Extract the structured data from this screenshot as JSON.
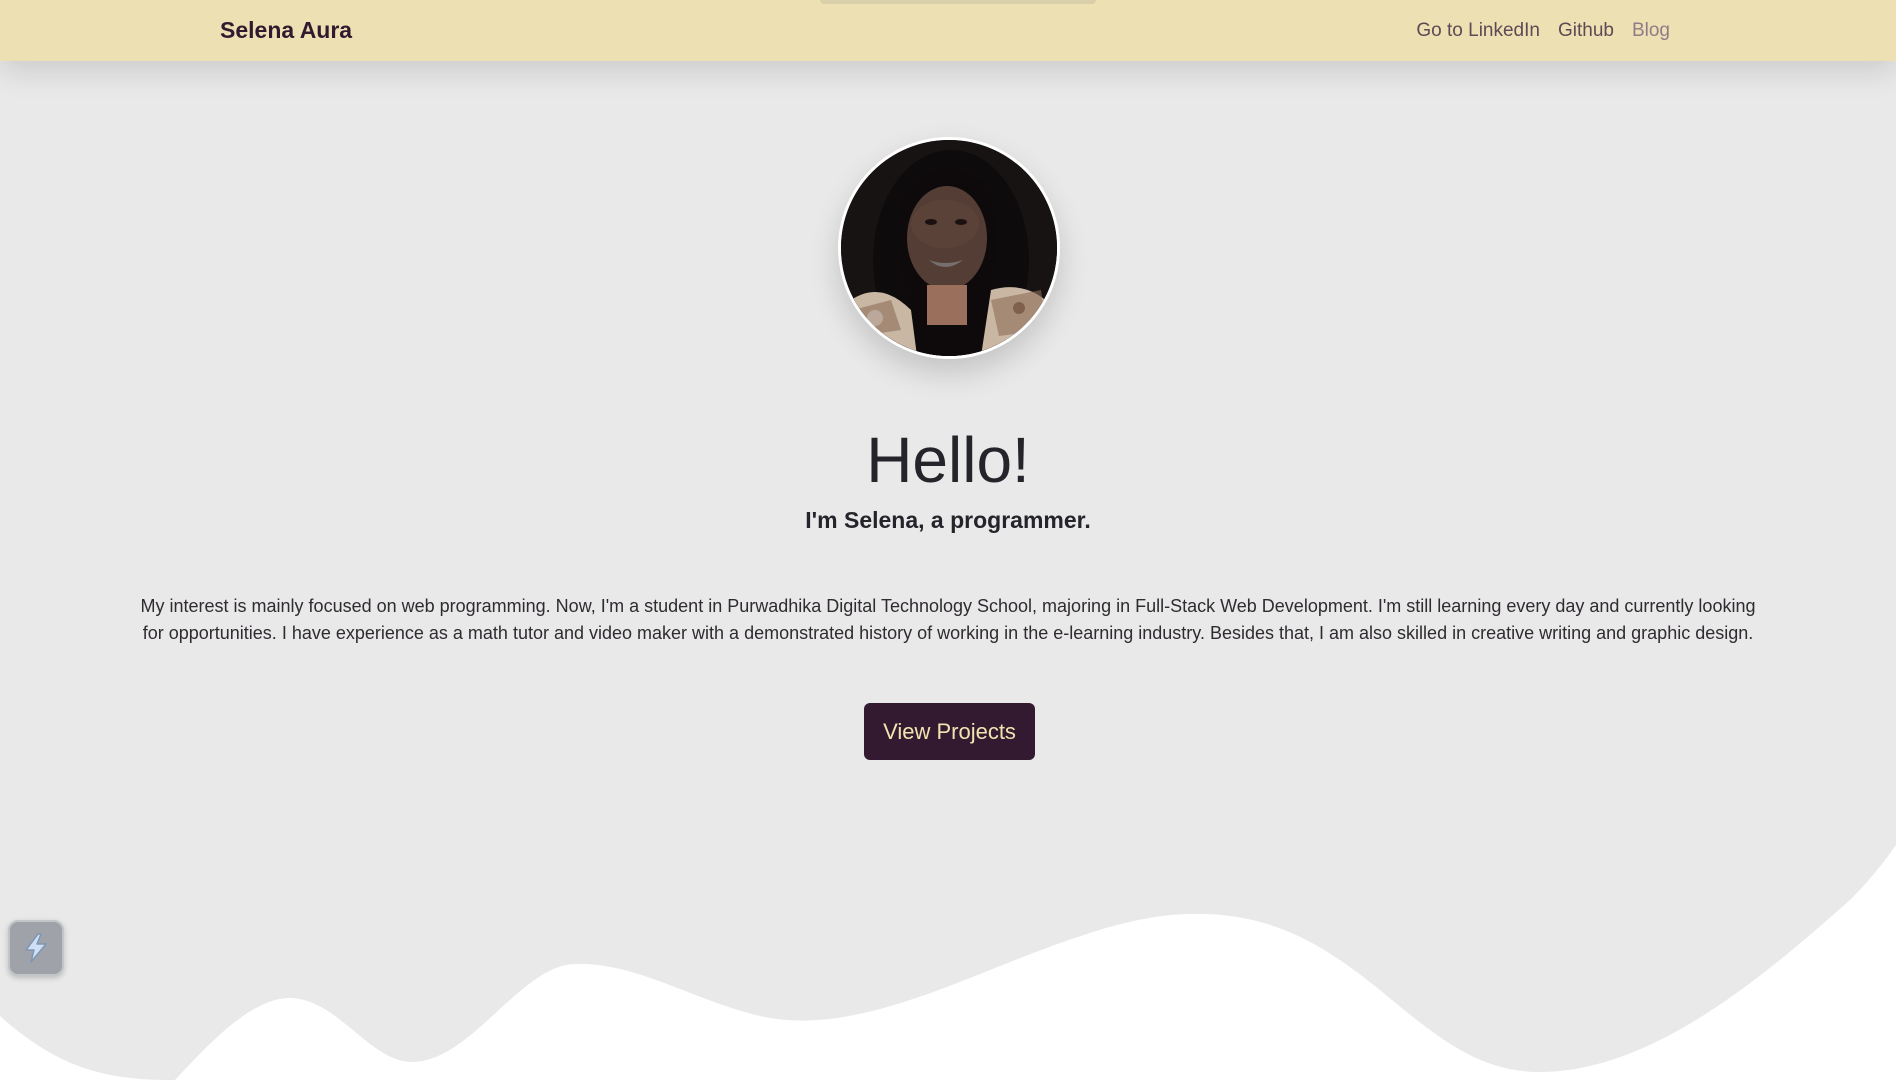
{
  "navbar": {
    "brand": "Selena Aura",
    "links": [
      {
        "label": "Go to LinkedIn"
      },
      {
        "label": "Github"
      },
      {
        "label": "Blog"
      }
    ]
  },
  "hero": {
    "title": "Hello!",
    "subtitle": "I'm Selena, a programmer.",
    "bio": "My interest is mainly focused on web programming. Now, I'm a student in Purwadhika Digital Technology School, majoring in Full-Stack Web Development. I'm still learning every day and currently looking for opportunities. I have experience as a math tutor and video maker with a demonstrated history of working in the e-learning industry. Besides that, I am also skilled in creative writing and graphic design.",
    "cta_label": "View Projects"
  },
  "widget": {
    "icon": "lightning-bolt-icon"
  },
  "colors": {
    "navbar_bg": "#ede1b4",
    "page_bg": "#e9e9e9",
    "brand_color": "#311a30",
    "button_bg": "#331a31",
    "button_text": "#f3e3b0",
    "wave": "#ffffff"
  }
}
